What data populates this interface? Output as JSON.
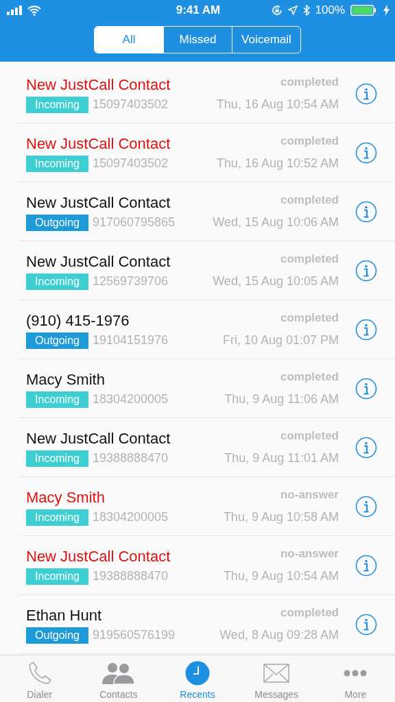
{
  "status_bar": {
    "time": "9:41 AM",
    "battery": "100%"
  },
  "filter_tabs": [
    {
      "label": "All",
      "selected": true
    },
    {
      "label": "Missed",
      "selected": false
    },
    {
      "label": "Voicemail",
      "selected": false
    }
  ],
  "calls": [
    {
      "name": "New JustCall Contact",
      "missed": true,
      "direction": "Incoming",
      "color": "#3ecfd3",
      "number": "15097403502",
      "status": "completed",
      "time": "Thu, 16 Aug 10:54 AM"
    },
    {
      "name": "New JustCall Contact",
      "missed": true,
      "direction": "Incoming",
      "color": "#3ecfd3",
      "number": "15097403502",
      "status": "completed",
      "time": "Thu, 16 Aug 10:52 AM"
    },
    {
      "name": "New JustCall Contact",
      "missed": false,
      "direction": "Outgoing",
      "color": "#1e9ad8",
      "number": "917060795865",
      "status": "completed",
      "time": "Wed, 15 Aug 10:06 AM"
    },
    {
      "name": "New JustCall Contact",
      "missed": false,
      "direction": "Incoming",
      "color": "#3ecfd3",
      "number": "12569739706",
      "status": "completed",
      "time": "Wed, 15 Aug 10:05 AM"
    },
    {
      "name": "(910) 415-1976",
      "missed": false,
      "direction": "Outgoing",
      "color": "#1e9ad8",
      "number": "19104151976",
      "status": "completed",
      "time": "Fri, 10 Aug 01:07 PM"
    },
    {
      "name": "Macy Smith",
      "missed": false,
      "direction": "Incoming",
      "color": "#3ecfd3",
      "number": "18304200005",
      "status": "completed",
      "time": "Thu, 9 Aug 11:06 AM"
    },
    {
      "name": "New JustCall Contact",
      "missed": false,
      "direction": "Incoming",
      "color": "#3ecfd3",
      "number": "19388888470",
      "status": "completed",
      "time": "Thu, 9 Aug 11:01 AM"
    },
    {
      "name": "Macy Smith",
      "missed": true,
      "direction": "Incoming",
      "color": "#3ecfd3",
      "number": "18304200005",
      "status": "no-answer",
      "time": "Thu, 9 Aug 10:58 AM"
    },
    {
      "name": "New JustCall Contact",
      "missed": true,
      "direction": "Incoming",
      "color": "#3ecfd3",
      "number": "19388888470",
      "status": "no-answer",
      "time": "Thu, 9 Aug 10:54 AM"
    },
    {
      "name": "Ethan Hunt",
      "missed": false,
      "direction": "Outgoing",
      "color": "#1e9ad8",
      "number": "919560576199",
      "status": "completed",
      "time": "Wed, 8 Aug 09:28 AM"
    }
  ],
  "tab_bar": [
    {
      "kind": "phone",
      "label": "Dialer",
      "selected": false
    },
    {
      "kind": "contacts",
      "label": "Contacts",
      "selected": false
    },
    {
      "kind": "clock",
      "label": "Recents",
      "selected": true
    },
    {
      "kind": "envelope",
      "label": "Messages",
      "selected": false
    },
    {
      "kind": "dots",
      "label": "More",
      "selected": false
    }
  ]
}
